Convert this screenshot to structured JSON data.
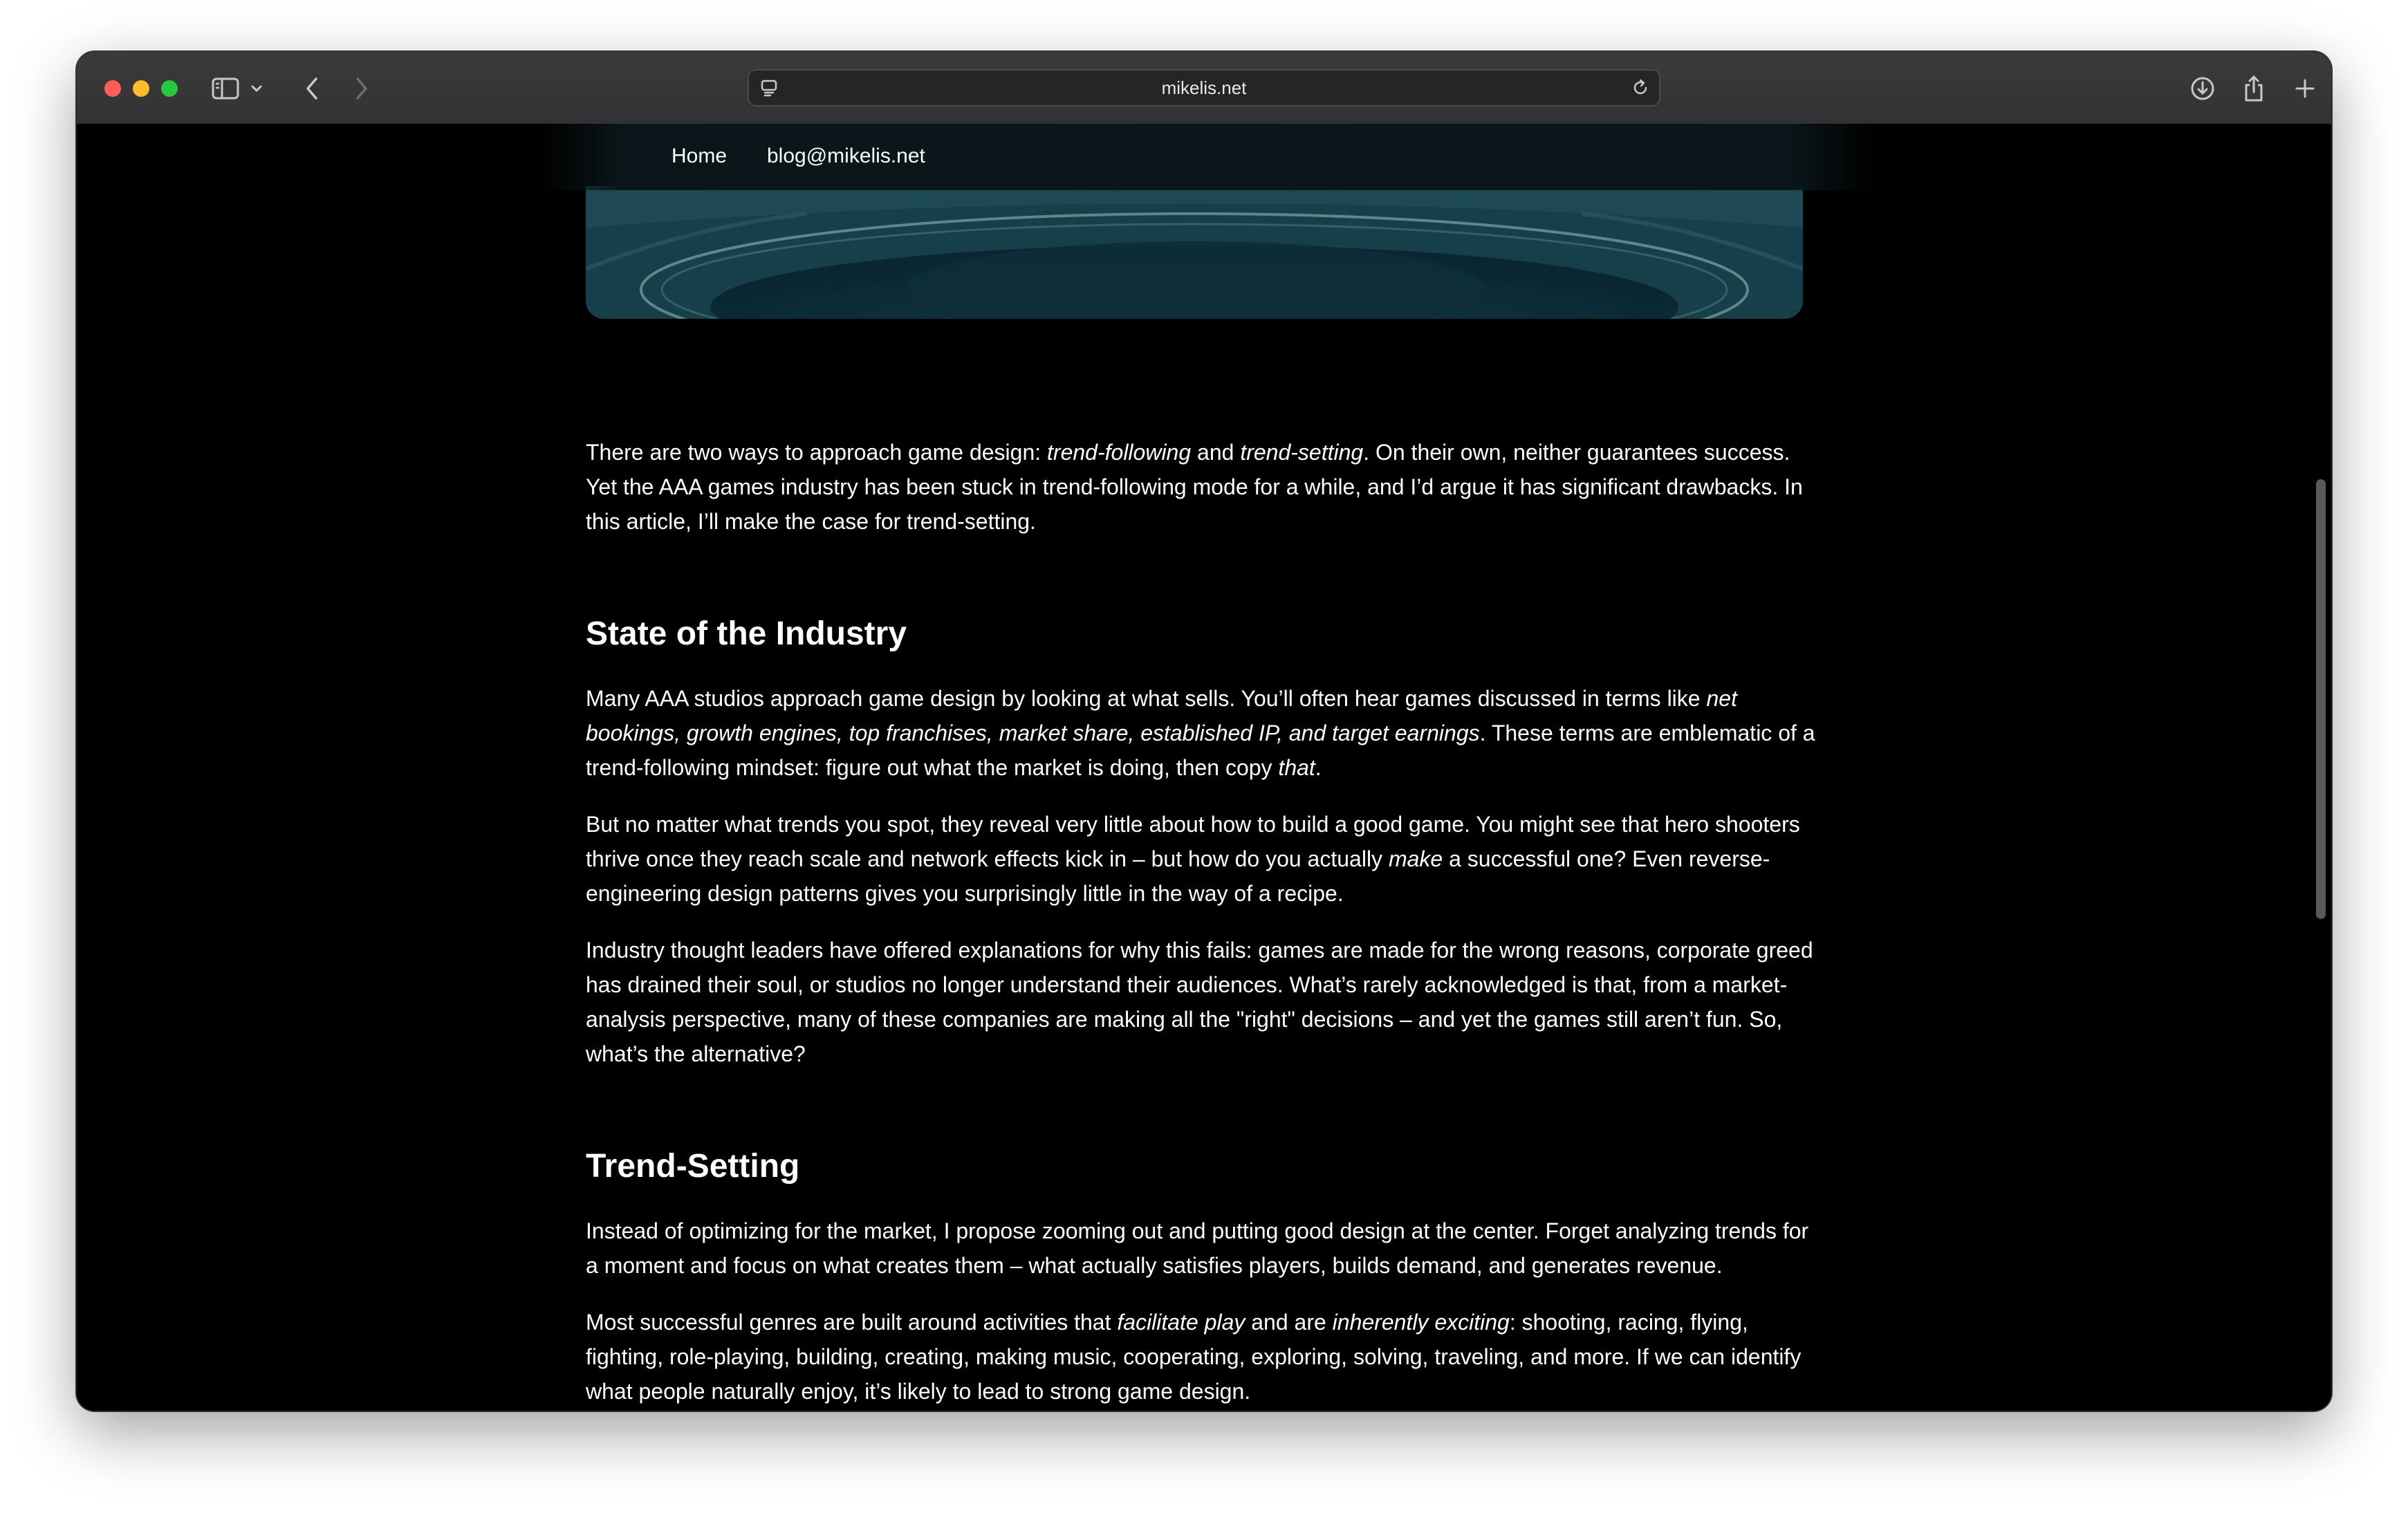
{
  "browser": {
    "url": "mikelis.net"
  },
  "site_nav": {
    "items": [
      "Home",
      "blog@mikelis.net"
    ]
  },
  "article": {
    "intro": {
      "t1": "There are two ways to approach game design: ",
      "em1": "trend-following",
      "t2": " and ",
      "em2": "trend-setting",
      "t3": ". On their own, neither guarantees success. Yet the AAA games industry has been stuck in trend-following mode for a while, and I’d argue it has significant drawbacks. In this article, I’ll make the case for trend-setting."
    },
    "section1": {
      "heading": "State of the Industry",
      "p1": {
        "t1": "Many AAA studios approach game design by looking at what sells. You’ll often hear games discussed in terms like ",
        "em1": "net bookings, growth engines, top franchises, market share, established IP, and target earnings",
        "t2": ". These terms are emblematic of a trend-following mindset: figure out what the market is doing, then copy ",
        "em2": "that",
        "t3": "."
      },
      "p2": {
        "t1": "But no matter what trends you spot, they reveal very little about how to build a good game. You might see that hero shooters thrive once they reach scale and network effects kick in – but how do you actually ",
        "em1": "make",
        "t2": " a successful one? Even reverse-engineering design patterns gives you surprisingly little in the way of a recipe."
      },
      "p3": "Industry thought leaders have offered explanations for why this fails: games are made for the wrong reasons, corporate greed has drained their soul, or studios no longer understand their audiences. What’s rarely acknowledged is that, from a market-analysis perspective, many of these companies are making all the \"right\" decisions – and yet the games still aren’t fun. So, what’s the alternative?"
    },
    "section2": {
      "heading": "Trend-Setting",
      "p1": "Instead of optimizing for the market, I propose zooming out and putting good design at the center. Forget analyzing trends for a moment and focus on what creates them – what actually satisfies players, builds demand, and generates revenue.",
      "p2": {
        "t1": "Most successful genres are built around activities that ",
        "em1": "facilitate play",
        "t2": " and are ",
        "em2": "inherently exciting",
        "t3": ": shooting, racing, flying, fighting, role-playing, building, creating, making music, cooperating, exploring, solving, traveling, and more. If we can identify what people naturally enjoy, it’s likely to lead to strong game design."
      }
    }
  },
  "icons": {
    "sidebar": "sidebar-icon",
    "chevron": "chevron-down-icon",
    "back": "back-arrow-icon",
    "forward": "forward-arrow-icon",
    "site": "site-settings-icon",
    "reload": "reload-icon",
    "download": "download-icon",
    "share": "share-icon",
    "new_tab": "plus-icon",
    "tab_overview": "tab-overview-icon"
  },
  "colors": {
    "page_background": "#000000",
    "text": "#ffffff",
    "toolbar": "#38383a",
    "close": "#ff5f57",
    "minimize": "#febc2e",
    "maximize": "#28c840"
  }
}
